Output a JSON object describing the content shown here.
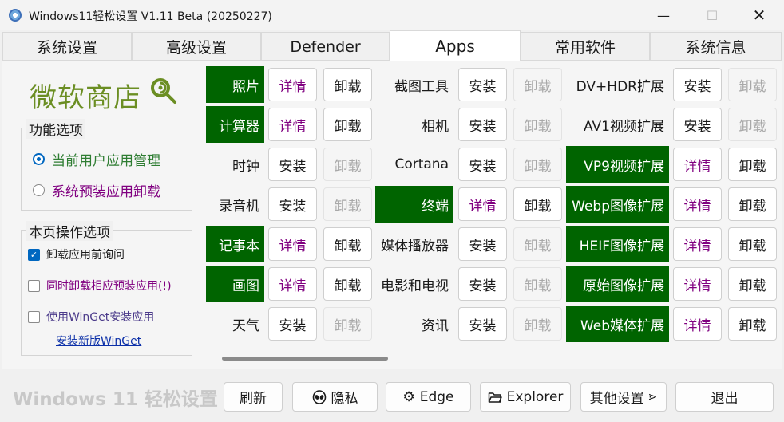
{
  "window": {
    "title": "Windows11轻松设置 V1.11 Beta (20250227)",
    "minimize_glyph": "—",
    "maximize_glyph": "☐",
    "close_glyph": "✕"
  },
  "tabs": [
    {
      "label": "系统设置"
    },
    {
      "label": "高级设置"
    },
    {
      "label": "Defender"
    },
    {
      "label": "Apps"
    },
    {
      "label": "常用软件"
    },
    {
      "label": "系统信息"
    }
  ],
  "left_panel": {
    "store_title": "微软商店",
    "options_group": {
      "title": "功能选项",
      "radio_current_user": "当前用户应用管理",
      "radio_preinstalled": "系统预装应用卸载"
    },
    "page_options_group": {
      "title": "本页操作选项",
      "ask_before_uninstall": "卸载应用前询问",
      "uninstall_preinstalled_too": "同时卸载相应预装应用(!)",
      "use_winget": "使用WinGet安装应用",
      "install_winget_link": "安装新版WinGet"
    }
  },
  "apps": {
    "detail_label": "详情",
    "install_label": "安装",
    "uninstall_label": "卸载",
    "columns": [
      [
        {
          "name": "照片",
          "installed": true
        },
        {
          "name": "计算器",
          "installed": true
        },
        {
          "name": "时钟",
          "installed": false
        },
        {
          "name": "录音机",
          "installed": false
        },
        {
          "name": "记事本",
          "installed": true
        },
        {
          "name": "画图",
          "installed": true
        },
        {
          "name": "天气",
          "installed": false
        }
      ],
      [
        {
          "name": "截图工具",
          "installed": false
        },
        {
          "name": "相机",
          "installed": false
        },
        {
          "name": "Cortana",
          "installed": false
        },
        {
          "name": "终端",
          "installed": true
        },
        {
          "name": "媒体播放器",
          "installed": false
        },
        {
          "name": "电影和电视",
          "installed": false
        },
        {
          "name": "资讯",
          "installed": false
        }
      ],
      [
        {
          "name": "DV+HDR扩展",
          "installed": false
        },
        {
          "name": "AV1视频扩展",
          "installed": false
        },
        {
          "name": "VP9视频扩展",
          "installed": true
        },
        {
          "name": "Webp图像扩展",
          "installed": true
        },
        {
          "name": "HEIF图像扩展",
          "installed": true
        },
        {
          "name": "原始图像扩展",
          "installed": true
        },
        {
          "name": "Web媒体扩展",
          "installed": true
        }
      ]
    ]
  },
  "bottom_bar": {
    "brand": "Windows 11 轻松设置",
    "refresh": "刷新",
    "privacy": "隐私",
    "edge": "Edge",
    "explorer": "Explorer",
    "other_settings": "其他设置",
    "exit": "退出"
  },
  "colors": {
    "installed_bg": "#006400",
    "detail_text": "#800080",
    "brand_green": "#6b8e23",
    "accent_blue": "#0067c0"
  }
}
